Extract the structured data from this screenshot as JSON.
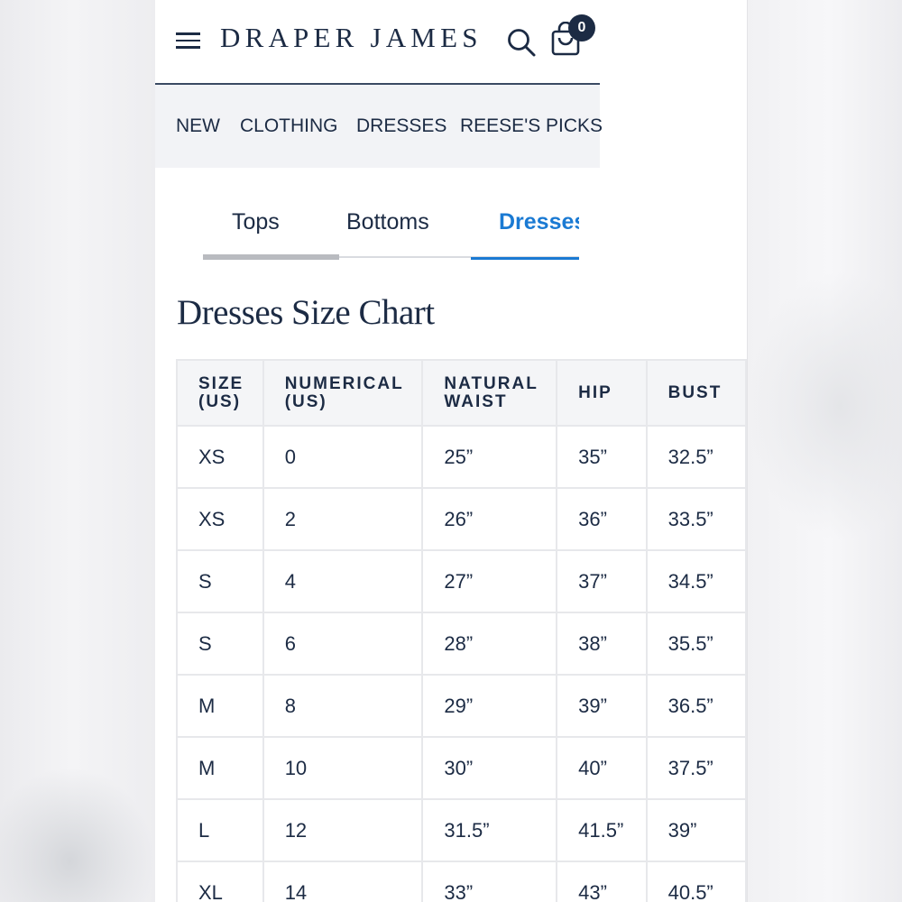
{
  "header": {
    "brand": "DRAPER JAMES",
    "cart_count": "0"
  },
  "nav": {
    "items": [
      "NEW",
      "CLOTHING",
      "DRESSES",
      "REESE'S PICKS"
    ]
  },
  "tabs": [
    {
      "label": "Tops"
    },
    {
      "label": "Bottoms"
    },
    {
      "label": "Dresses",
      "active": true
    }
  ],
  "page_title": "Dresses Size Chart",
  "table": {
    "headers": [
      [
        "SIZE",
        "(US)"
      ],
      [
        "NUMERICAL",
        "(US)"
      ],
      [
        "NATURAL",
        "WAIST"
      ],
      [
        "HIP"
      ],
      [
        "BUST"
      ]
    ],
    "rows": [
      [
        "XS",
        "0",
        "25”",
        "35”",
        "32.5”"
      ],
      [
        "XS",
        "2",
        "26”",
        "36”",
        "33.5”"
      ],
      [
        "S",
        "4",
        "27”",
        "37”",
        "34.5”"
      ],
      [
        "S",
        "6",
        "28”",
        "38”",
        "35.5”"
      ],
      [
        "M",
        "8",
        "29”",
        "39”",
        "36.5”"
      ],
      [
        "M",
        "10",
        "30”",
        "40”",
        "37.5”"
      ],
      [
        "L",
        "12",
        "31.5”",
        "41.5”",
        "39”"
      ],
      [
        "XL",
        "14",
        "33”",
        "43”",
        "40.5”"
      ]
    ]
  },
  "colors": {
    "navy": "#1c2b44",
    "accent": "#1a7ad3",
    "nav_bg": "#f2f3f6"
  }
}
